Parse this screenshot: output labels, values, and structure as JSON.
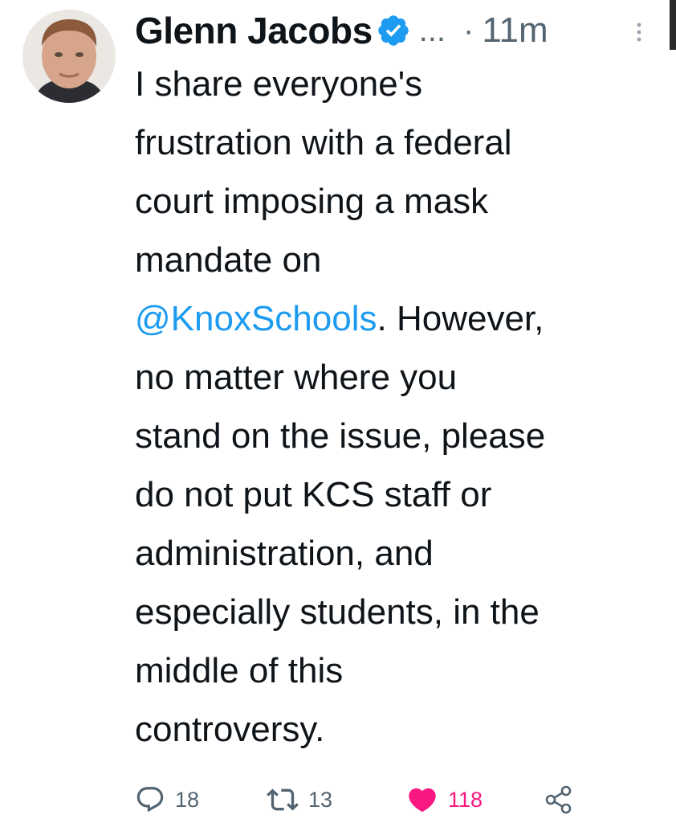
{
  "tweet": {
    "author_name": "Glenn Jacobs",
    "truncated_handle": "...",
    "separator": "·",
    "timestamp": "11m",
    "text_lines": [
      "I share everyone's",
      "frustration with a federal",
      "court imposing a mask",
      "mandate on"
    ],
    "mention": "@KnoxSchools",
    "mention_suffix": ". However,",
    "text_lines_after": [
      "no matter where you",
      "stand on the issue, please",
      "do not put KCS staff or",
      "administration, and",
      "especially students, in the",
      "middle of this",
      "controversy."
    ],
    "icons": {
      "verified": "verified-badge-icon",
      "more": "more-vertical-icon",
      "reply": "reply-icon",
      "retweet": "retweet-icon",
      "like": "heart-icon",
      "share": "share-icon"
    },
    "colors": {
      "text": "#0f1419",
      "secondary": "#536471",
      "link": "#1d9bf0",
      "like": "#f91880"
    }
  },
  "actions": {
    "reply_count": "18",
    "retweet_count": "13",
    "like_count": "118"
  }
}
